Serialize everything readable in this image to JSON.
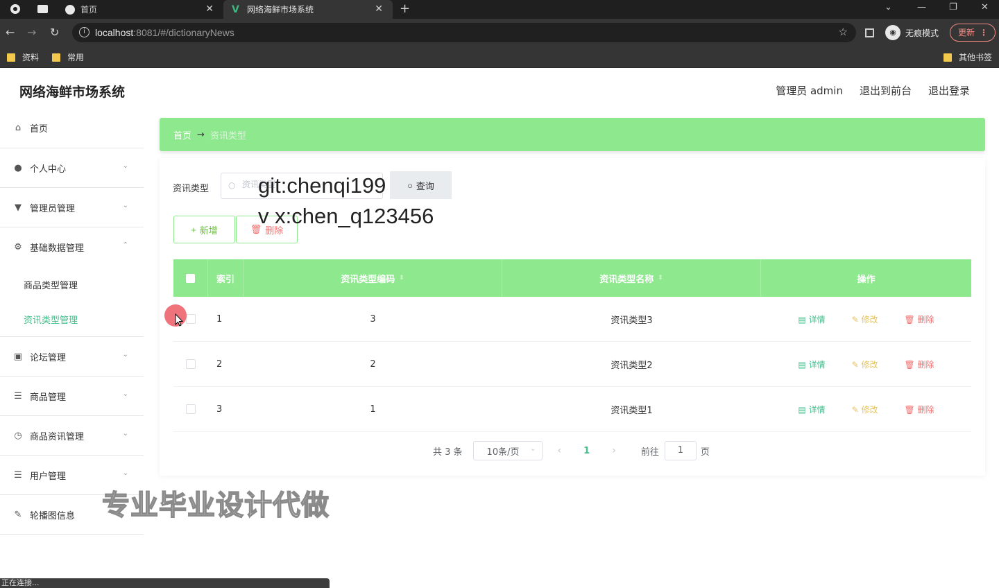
{
  "browser": {
    "tabs": [
      {
        "title": "首页"
      },
      {
        "title": "网络海鲜市场系统"
      }
    ],
    "url_host": "localhost",
    "url_rest": ":8081/#/dictionaryNews",
    "incognito_label": "无痕模式",
    "update_label": "更新",
    "bookmarks": [
      "资料",
      "常用"
    ],
    "other_bookmarks": "其他书签",
    "status": "正在连接..."
  },
  "header": {
    "title": "网络海鲜市场系统",
    "user": "管理员 admin",
    "to_front": "退出到前台",
    "logout": "退出登录"
  },
  "sidebar": {
    "home": "首页",
    "items": [
      {
        "label": "个人中心",
        "icon": "user-icon"
      },
      {
        "label": "管理员管理",
        "icon": "admin-icon"
      },
      {
        "label": "基础数据管理",
        "icon": "settings-icon"
      },
      {
        "label": "论坛管理",
        "icon": "forum-icon"
      },
      {
        "label": "商品管理",
        "icon": "menu-icon"
      },
      {
        "label": "商品资讯管理",
        "icon": "clock-icon"
      },
      {
        "label": "用户管理",
        "icon": "menu-icon"
      },
      {
        "label": "轮播图信息",
        "icon": "edit-icon"
      }
    ],
    "sub_items": [
      "商品类型管理",
      "资讯类型管理"
    ]
  },
  "breadcrumb": {
    "home": "首页",
    "arrow": "→",
    "current": "资讯类型"
  },
  "search": {
    "label": "资讯类型",
    "placeholder": "资讯类型",
    "query_btn": "查询"
  },
  "actions": {
    "add": "新增",
    "delete": "删除"
  },
  "table": {
    "headers": [
      "索引",
      "资讯类型编码",
      "资讯类型名称",
      "操作"
    ],
    "rows": [
      {
        "index": "1",
        "code": "3",
        "name": "资讯类型3"
      },
      {
        "index": "2",
        "code": "2",
        "name": "资讯类型2"
      },
      {
        "index": "3",
        "code": "1",
        "name": "资讯类型1"
      }
    ],
    "op_detail": "详情",
    "op_edit": "修改",
    "op_delete": "删除"
  },
  "pagination": {
    "total": "共 3 条",
    "page_size": "10条/页",
    "current_page": "1",
    "goto_label": "前往",
    "goto_value": "1",
    "page_unit": "页"
  },
  "watermarks": {
    "line1": "git:chenqi199",
    "line2": "v x:chen_q123456",
    "line3": "专业毕业设计代做"
  },
  "colors": {
    "accent_green": "#8ee88e",
    "active_text": "#43c08c",
    "danger": "#f56c6c",
    "warning": "#e6c35c"
  }
}
